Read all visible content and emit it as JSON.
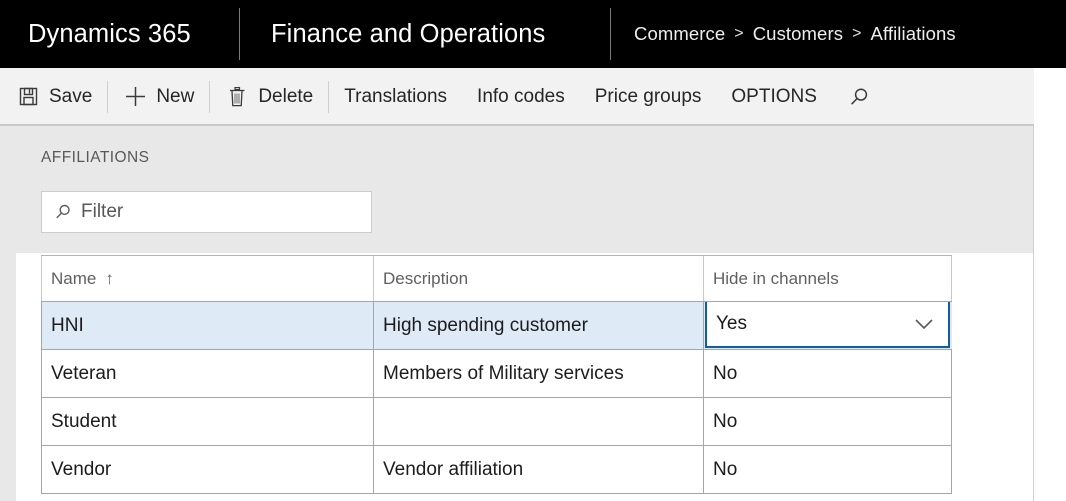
{
  "topbar": {
    "product": "Dynamics 365",
    "module": "Finance and Operations",
    "breadcrumb": [
      "Commerce",
      "Customers",
      "Affiliations"
    ],
    "separator": ">"
  },
  "toolbar": {
    "buttons": [
      {
        "label": "Save",
        "icon": "save-icon"
      },
      {
        "label": "New",
        "icon": "plus-icon"
      },
      {
        "label": "Delete",
        "icon": "trash-icon"
      },
      {
        "label": "Translations",
        "icon": null
      },
      {
        "label": "Info codes",
        "icon": null
      },
      {
        "label": "Price groups",
        "icon": null
      },
      {
        "label": "OPTIONS",
        "icon": null
      }
    ],
    "search_icon": "search-icon"
  },
  "page": {
    "section_title": "AFFILIATIONS"
  },
  "filter": {
    "icon": "search-icon",
    "value": "",
    "placeholder": "Filter"
  },
  "grid": {
    "columns": [
      {
        "key": "name",
        "label": "Name",
        "sorted": "asc",
        "sort_glyph": "↑"
      },
      {
        "key": "description",
        "label": "Description",
        "sorted": null,
        "sort_glyph": ""
      },
      {
        "key": "hide_in_channels",
        "label": "Hide in channels",
        "sorted": null,
        "sort_glyph": ""
      }
    ],
    "rows": [
      {
        "name": "HNI",
        "description": "High spending customer",
        "hide_in_channels": "Yes",
        "selected": true,
        "editing_cell": "hide_in_channels"
      },
      {
        "name": "Veteran",
        "description": "Members of Military services",
        "hide_in_channels": "No",
        "selected": false,
        "editing_cell": null
      },
      {
        "name": "Student",
        "description": "",
        "hide_in_channels": "No",
        "selected": false,
        "editing_cell": null
      },
      {
        "name": "Vendor",
        "description": "Vendor affiliation",
        "hide_in_channels": "No",
        "selected": false,
        "editing_cell": null
      }
    ]
  },
  "colors": {
    "topbar_bg": "#000000",
    "toolbar_bg": "#f2f2f2",
    "content_bg": "#e8e8e8",
    "grid_bg": "#ffffff",
    "selected_row": "#deeaf6",
    "focus_border": "#135d9e",
    "grid_line": "#a6a6a6"
  }
}
